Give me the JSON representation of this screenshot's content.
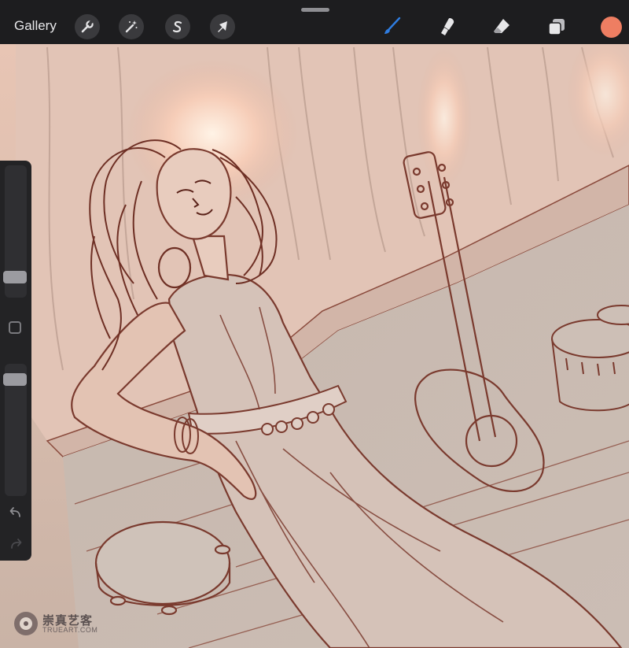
{
  "app": {
    "gallery_label": "Gallery"
  },
  "toolbar": {
    "left_tools": [
      {
        "name": "actions",
        "icon": "wrench-icon"
      },
      {
        "name": "adjustments",
        "icon": "magic-wand-icon"
      },
      {
        "name": "selection",
        "icon": "selection-s-icon"
      },
      {
        "name": "transform",
        "icon": "arrow-cursor-icon"
      }
    ],
    "right_tools": [
      {
        "name": "brush",
        "icon": "brush-icon",
        "active": true
      },
      {
        "name": "smudge",
        "icon": "smudge-finger-icon"
      },
      {
        "name": "eraser",
        "icon": "eraser-icon"
      },
      {
        "name": "layers",
        "icon": "layers-icon"
      }
    ],
    "current_color": "#ee7e62",
    "active_tool_color": "#2f7de1"
  },
  "sidebar": {
    "brush_size_level": 0.12,
    "opacity_level": 0.92,
    "undo_icon": "undo-arrow-icon",
    "redo_icon": "redo-arrow-icon"
  },
  "watermark": {
    "cn": "崇真艺客",
    "en": "TRUEART.COM"
  }
}
